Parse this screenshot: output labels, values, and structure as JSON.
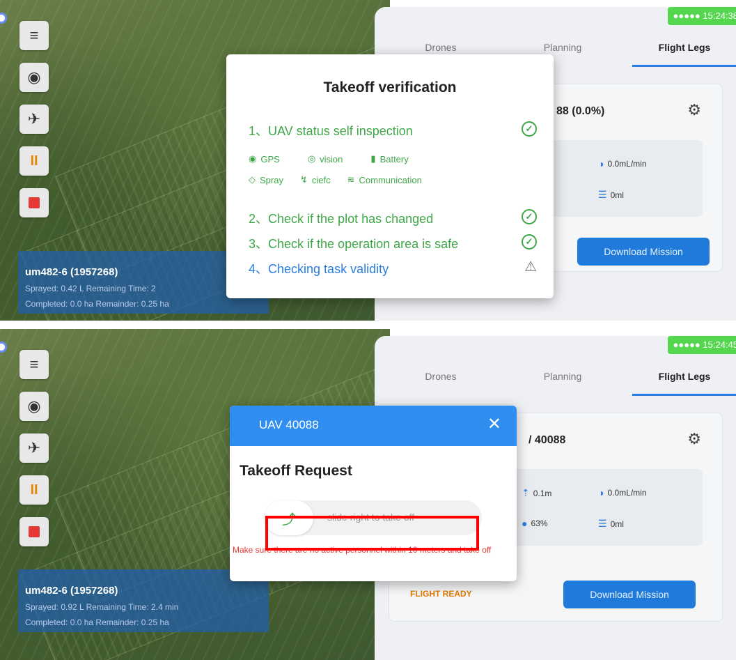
{
  "top": {
    "time": "15:24:38",
    "tabs": [
      "Drones",
      "Planning",
      "Flight Legs"
    ],
    "card_title": "88 (0.0%)",
    "flow": "0.0mL/min",
    "volume": "0ml",
    "download_label": "Download Mission",
    "drone": {
      "name": "um482-6 (1957268)",
      "row1": "Sprayed: 0.42 L  Remaining Time: 2",
      "row2": "Completed: 0.0 ha  Remainder: 0.25 ha"
    },
    "dialog": {
      "title": "Takeoff verification",
      "step1": "1、UAV status self inspection",
      "sub1": [
        "GPS",
        "vision",
        "Battery"
      ],
      "sub2": [
        "Spray",
        "ciefc",
        "Communication"
      ],
      "step2": "2、Check if the plot has changed",
      "step3": "3、Check if the operation area is safe",
      "step4": "4、Checking task validity"
    }
  },
  "bottom": {
    "time": "15:24:45",
    "tabs": [
      "Drones",
      "Planning",
      "Flight Legs"
    ],
    "card_title": "/ 40088",
    "height": "0.1m",
    "battery": "63%",
    "flow": "0.0mL/min",
    "volume": "0ml",
    "flight_ready": "FLIGHT READY",
    "download_label": "Download Mission",
    "drone": {
      "name": "um482-6 (1957268)",
      "row1": "Sprayed: 0.92 L  Remaining Time: 2.4 min",
      "row2": "Completed: 0.0 ha  Remainder: 0.25 ha"
    },
    "dialog": {
      "header": "UAV 40088",
      "title": "Takeoff Request",
      "slider_text": "slide right to take off",
      "warning": "Make sure there are no active personnel within 10 meters and take off"
    }
  },
  "colors": {
    "accent": "#2f8ef0",
    "success": "#3fa648",
    "danger": "#e53935",
    "time_badge": "#55d64f"
  }
}
